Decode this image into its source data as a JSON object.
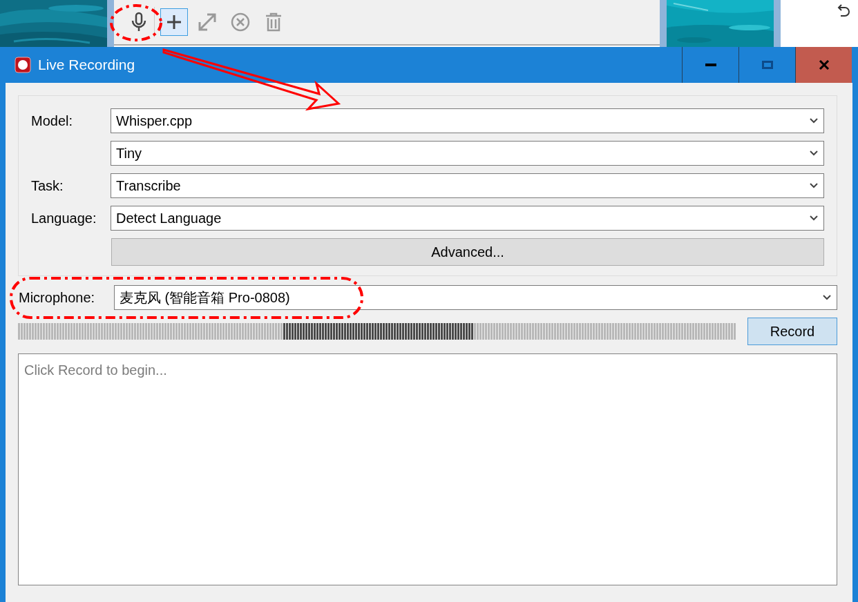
{
  "toolbar": {
    "buttons": [
      {
        "kind": "microphone",
        "selected": false
      },
      {
        "kind": "plus",
        "selected": true
      },
      {
        "kind": "expand",
        "selected": false
      },
      {
        "kind": "cancel",
        "selected": false
      },
      {
        "kind": "trash",
        "selected": false
      }
    ]
  },
  "window": {
    "title": "Live Recording"
  },
  "settings": [
    {
      "label": "Model:",
      "value": "Whisper.cpp"
    },
    {
      "value": "Tiny"
    },
    {
      "label": "Task:",
      "value": "Transcribe"
    },
    {
      "label": "Language:",
      "value": "Detect Language"
    }
  ],
  "advanced_button": "Advanced...",
  "microphone": {
    "label": "Microphone:",
    "value": "麦克风 (智能音箱 Pro-0808)"
  },
  "record_button": "Record",
  "transcript": {
    "placeholder": "Click Record to begin..."
  }
}
